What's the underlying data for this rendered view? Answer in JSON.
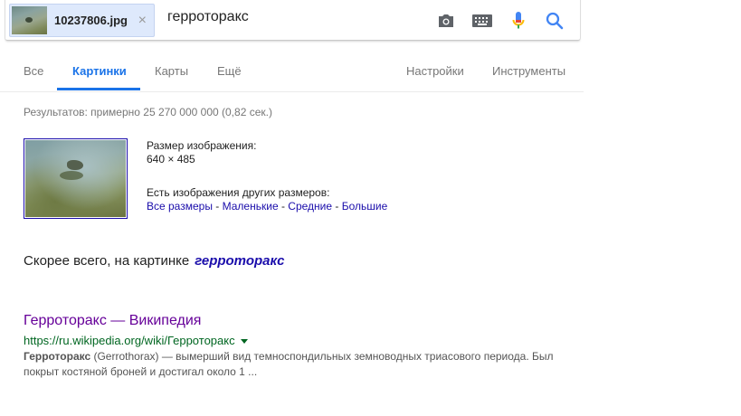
{
  "search": {
    "image_chip_name": "10237806.jpg",
    "image_chip_close": "×",
    "query": "герроторакс",
    "icons": [
      "camera-icon",
      "keyboard-icon",
      "microphone-icon",
      "search-icon"
    ]
  },
  "tabs": [
    {
      "label": "Все",
      "active": false
    },
    {
      "label": "Картинки",
      "active": true
    },
    {
      "label": "Карты",
      "active": false
    },
    {
      "label": "Ещё",
      "active": false
    }
  ],
  "tools": {
    "settings_label": "Настройки",
    "tools_label": "Инструменты"
  },
  "stats_text": "Результатов: примерно 25 270 000 000 (0,82 сек.)",
  "image_info": {
    "size_label": "Размер изображения:",
    "size_value": "640 × 485",
    "other_sizes_label": "Есть изображения других размеров:",
    "size_links": [
      "Все размеры",
      "Маленькие",
      "Средние",
      "Большие"
    ],
    "separator": " - "
  },
  "best_guess": {
    "label": "Скорее всего, на картинке",
    "term": "герроторакс"
  },
  "result": {
    "title": "Герроторакс — Википедия",
    "url": "https://ru.wikipedia.org/wiki/Герроторакс",
    "snippet_bold": "Герроторакс",
    "snippet_rest": " (Gerrothorax) — вымерший вид темноспондильных земноводных триасового периода. Был покрыт костяной броней и достигал около 1 ..."
  },
  "colors": {
    "accent_blue": "#1a73e8",
    "link_blue": "#1a0dab",
    "visited_purple": "#660099",
    "url_green": "#006621",
    "mic_red": "#ea4335"
  }
}
